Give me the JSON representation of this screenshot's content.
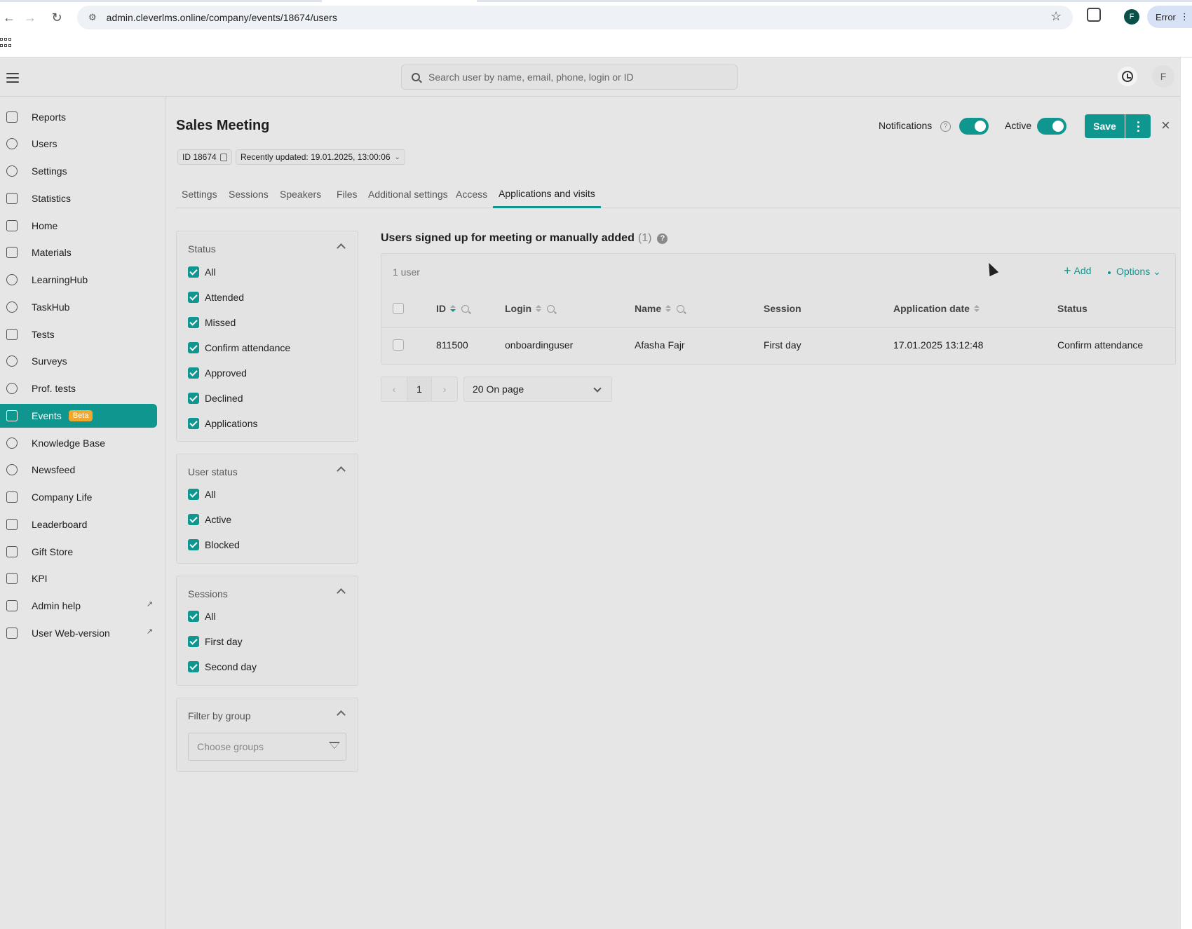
{
  "browser": {
    "url": "admin.cleverlms.online/company/events/18674/users",
    "profile_initial": "F",
    "error_label": "Error"
  },
  "header": {
    "search_placeholder": "Search user by name, email, phone, login or ID",
    "avatar_initial": "F"
  },
  "sidebar": {
    "items": [
      {
        "label": "Reports"
      },
      {
        "label": "Users"
      },
      {
        "label": "Settings"
      },
      {
        "label": "Statistics"
      },
      {
        "label": "Home"
      },
      {
        "label": "Materials"
      },
      {
        "label": "LearningHub"
      },
      {
        "label": "TaskHub"
      },
      {
        "label": "Tests"
      },
      {
        "label": "Surveys"
      },
      {
        "label": "Prof. tests"
      },
      {
        "label": "Events",
        "badge": "Beta",
        "active": true
      },
      {
        "label": "Knowledge Base"
      },
      {
        "label": "Newsfeed"
      },
      {
        "label": "Company Life"
      },
      {
        "label": "Leaderboard"
      },
      {
        "label": "Gift Store"
      },
      {
        "label": "KPI"
      },
      {
        "label": "Admin help",
        "external": true
      },
      {
        "label": "User Web-version",
        "external": true
      }
    ]
  },
  "event": {
    "title": "Sales Meeting",
    "id_label": "ID 18674",
    "updated_label": "Recently updated: 19.01.2025, 13:00:06",
    "notifications_label": "Notifications",
    "notifications_on": true,
    "active_label": "Active",
    "active_on": true,
    "save_label": "Save"
  },
  "tabs": [
    {
      "label": "Settings"
    },
    {
      "label": "Sessions"
    },
    {
      "label": "Speakers"
    },
    {
      "label": "Files"
    },
    {
      "label": "Additional settings"
    },
    {
      "label": "Access"
    },
    {
      "label": "Applications and visits",
      "active": true
    }
  ],
  "filters": {
    "status": {
      "title": "Status",
      "options": [
        "All",
        "Attended",
        "Missed",
        "Confirm attendance",
        "Approved",
        "Declined",
        "Applications"
      ]
    },
    "user_status": {
      "title": "User status",
      "options": [
        "All",
        "Active",
        "Blocked"
      ]
    },
    "sessions": {
      "title": "Sessions",
      "options": [
        "All",
        "First day",
        "Second day"
      ]
    },
    "group": {
      "title": "Filter by group",
      "placeholder": "Choose groups"
    }
  },
  "users_table": {
    "title": "Users signed up for meeting or manually added",
    "count": "(1)",
    "summary": "1 user",
    "add_label": "Add",
    "options_label": "Options",
    "columns": [
      "ID",
      "Login",
      "Name",
      "Session",
      "Application date",
      "Status"
    ],
    "rows": [
      {
        "id": "811500",
        "login": "onboardinguser",
        "name": "Afasha Fajr",
        "session": "First day",
        "date": "17.01.2025 13:12:48",
        "status": "Confirm attendance"
      }
    ]
  },
  "pagination": {
    "current_page": "1",
    "per_page": "20 On page"
  }
}
